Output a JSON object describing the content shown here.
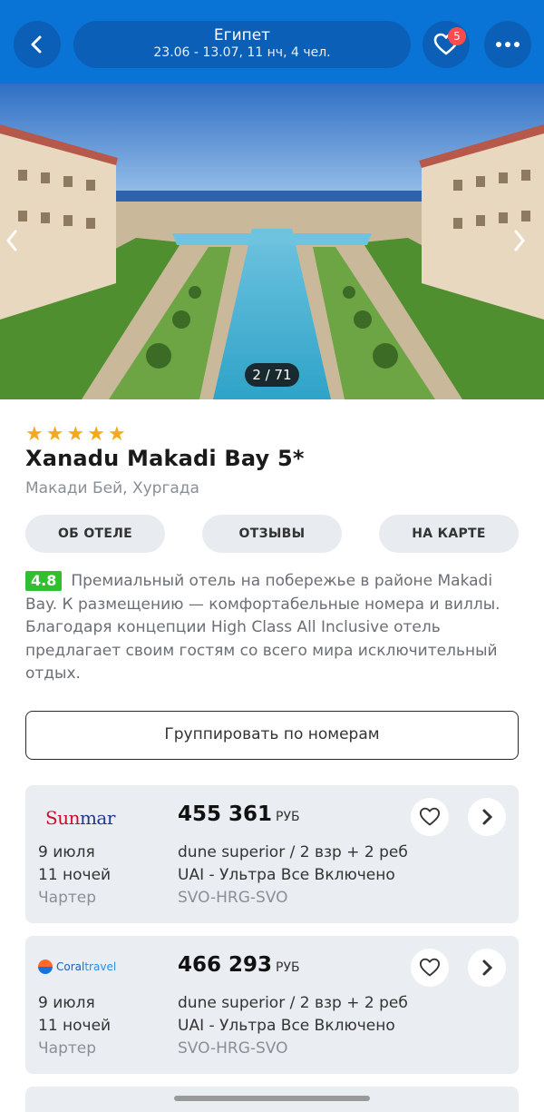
{
  "header": {
    "destination": "Египет",
    "dates": "23.06 - 13.07, 11 нч, 4 чел.",
    "favorites_count": "5",
    "icons": {
      "back": "chevron-left-icon",
      "favorites": "heart-icon",
      "more": "more-dots-icon"
    },
    "accent": "#0a74d6"
  },
  "gallery": {
    "counter": "2 / 71",
    "icons": {
      "prev": "chevron-left-icon",
      "next": "chevron-right-icon"
    }
  },
  "hotel": {
    "stars": 5,
    "name": "Xanadu Makadi Bay 5*",
    "location": "Макади Бей, Хургада",
    "rating": "4.8",
    "description": "Премиальный отель на побережье в районе Makadi Bay. К размещению — комфортабельные номера и виллы. Благодаря концепции High Class All Inclusive отель предлагает своим гостям со всего мира исключительный отдых."
  },
  "tabs": [
    "ОБ ОТЕЛЕ",
    "ОТЗЫВЫ",
    "НА КАРТЕ"
  ],
  "group_button": "Группировать по номерам",
  "offers": [
    {
      "operator": "Sunmar",
      "price": "455 361",
      "currency": "РУБ",
      "date": "9 июля",
      "nights": "11 ночей",
      "flight_type": "Чартер",
      "room": "dune superior / 2 взр + 2 реб",
      "meal": "UAI - Ультра Все Включено",
      "route": "SVO-HRG-SVO"
    },
    {
      "operator": "Coraltravel",
      "price": "466 293",
      "currency": "РУБ",
      "date": "9 июля",
      "nights": "11 ночей",
      "flight_type": "Чартер",
      "room": "dune superior / 2 взр + 2 реб",
      "meal": "UAI - Ультра Все Включено",
      "route": "SVO-HRG-SVO"
    }
  ]
}
